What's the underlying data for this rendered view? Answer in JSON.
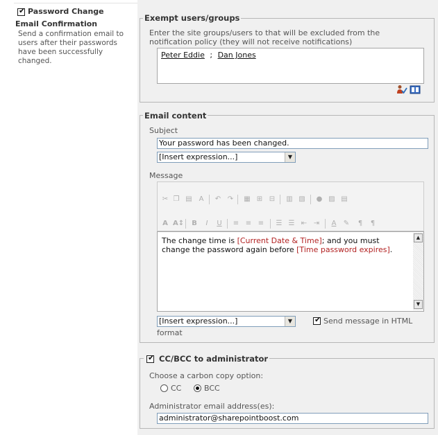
{
  "left": {
    "section_title": "Password Change",
    "subtitle": "Email Confirmation",
    "description_lines": [
      "Send a confirmation email to",
      "users after their passwords",
      "have been successfully",
      "changed."
    ]
  },
  "exempt": {
    "legend": "Exempt users/groups",
    "instruction_lines": [
      "Enter the site groups/users to that will be excluded from the",
      "notification policy (they will not receive notifications)"
    ],
    "user1": "Peter Eddie",
    "separator": ";",
    "user2": "Dan Jones",
    "check_names_icon": "check-names-icon",
    "address_book_icon": "address-book-icon"
  },
  "email_content": {
    "legend": "Email content",
    "subject_label": "Subject",
    "subject_value": "Your password has been changed.",
    "insert_expression": "[Insert expression...]",
    "message_label": "Message",
    "message_part1": "The change time is ",
    "message_token1": "[Current Date & Time]",
    "message_part2": "; and you must",
    "message_part3": "change the password again before ",
    "message_token2": "[Time password expires]",
    "message_part4": ".",
    "insert_expression2": "[Insert expression...]",
    "html_format_label": "Send message in HTML",
    "html_format_label2": "format"
  },
  "ccbcc": {
    "legend": "CC/BCC to administrator",
    "choose_label": "Choose a carbon copy option:",
    "cc_label": "CC",
    "bcc_label": "BCC",
    "admin_label": "Administrator email address(es):",
    "admin_value": "administrator@sharepointboost.com"
  },
  "toolbar_icons_row1": [
    "cut-icon",
    "copy-icon",
    "paste-icon",
    "format-painter-icon",
    "undo-icon",
    "redo-icon",
    "table-icon",
    "insert-row-icon",
    "insert-column-icon",
    "merge-icon",
    "split-icon",
    "link-icon",
    "image-icon",
    "html-source-icon"
  ],
  "toolbar_icons_row2": [
    "font-icon",
    "font-size-icon",
    "bold-icon",
    "italic-icon",
    "underline-icon",
    "align-left-icon",
    "align-center-icon",
    "align-right-icon",
    "numbered-list-icon",
    "bullet-list-icon",
    "decrease-indent-icon",
    "increase-indent-icon",
    "text-color-icon",
    "highlight-icon",
    "ltr-icon",
    "rtl-icon"
  ]
}
